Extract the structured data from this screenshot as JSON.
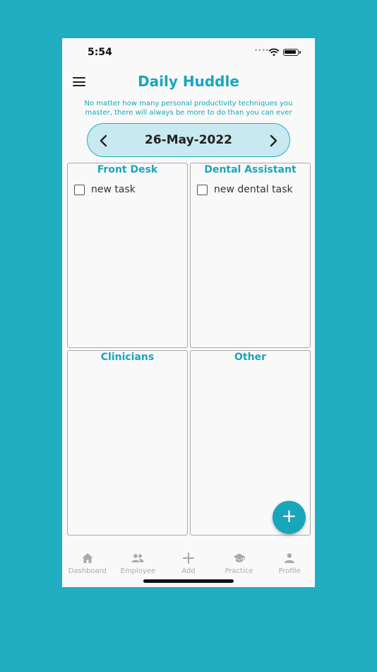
{
  "status_bar": {
    "time": "5:54"
  },
  "header": {
    "title": "Daily Huddle",
    "quote": "No matter how many personal productivity techniques you master, there will always be more to do than you can ever"
  },
  "date_nav": {
    "date": "26-May-2022"
  },
  "panels": [
    {
      "title": "Front Desk",
      "tasks": [
        {
          "label": "new task",
          "checked": false
        }
      ]
    },
    {
      "title": "Dental Assistant",
      "tasks": [
        {
          "label": "new dental task",
          "checked": false
        }
      ]
    },
    {
      "title": "Clinicians",
      "tasks": []
    },
    {
      "title": "Other",
      "tasks": []
    }
  ],
  "fab": {
    "icon": "plus-icon",
    "label": "+"
  },
  "bottom_nav": [
    {
      "label": "Dashboard",
      "icon": "home-icon"
    },
    {
      "label": "Employee",
      "icon": "people-icon"
    },
    {
      "label": "Add",
      "icon": "plus-icon"
    },
    {
      "label": "Practice",
      "icon": "graduation-cap-icon"
    },
    {
      "label": "Profile",
      "icon": "person-icon"
    }
  ],
  "colors": {
    "background": "#21adc1",
    "accent": "#19a6bb",
    "date_pill": "#c8e9ef",
    "nav_inactive": "#aaaaaa"
  }
}
